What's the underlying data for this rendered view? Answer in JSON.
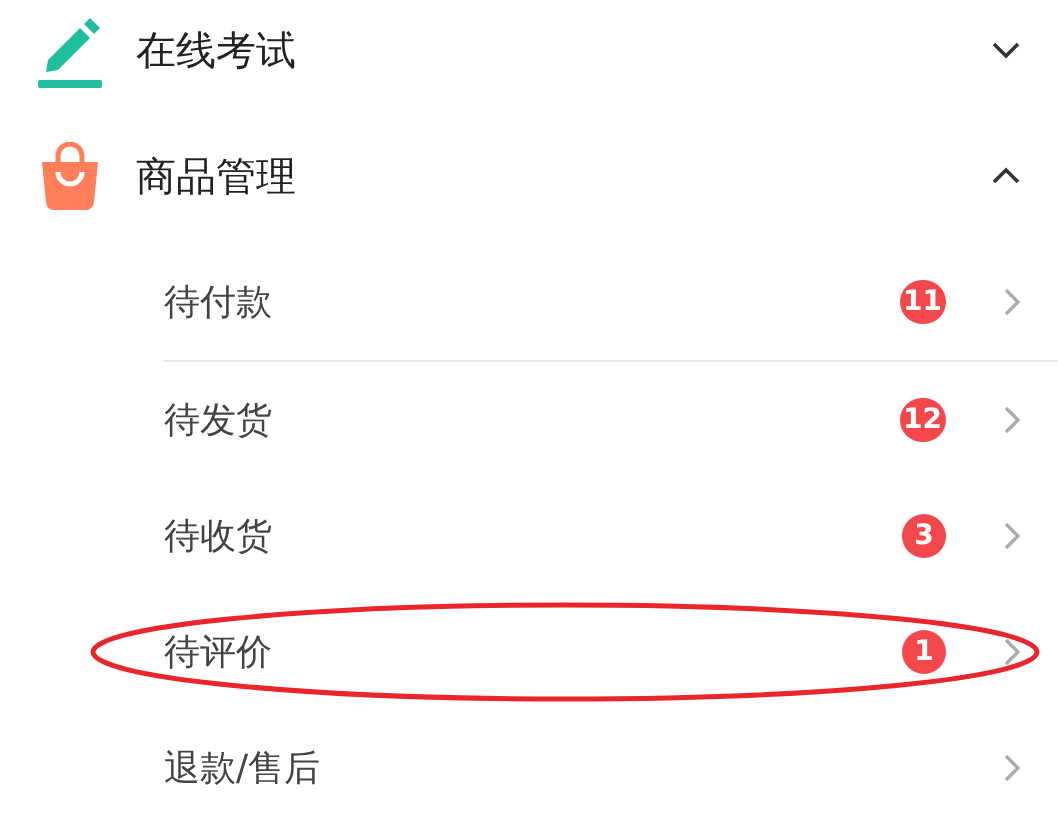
{
  "menu": [
    {
      "label": "在线考试",
      "expanded": false
    },
    {
      "label": "商品管理",
      "expanded": true,
      "children": [
        {
          "label": "待付款",
          "badge": "11",
          "divider": true,
          "circled": false
        },
        {
          "label": "待发货",
          "badge": "12",
          "divider": false,
          "circled": false
        },
        {
          "label": "待收货",
          "badge": "3",
          "divider": false,
          "circled": false
        },
        {
          "label": "待评价",
          "badge": "1",
          "divider": false,
          "circled": true
        },
        {
          "label": "退款/售后",
          "divider": false,
          "circled": false
        }
      ]
    }
  ]
}
